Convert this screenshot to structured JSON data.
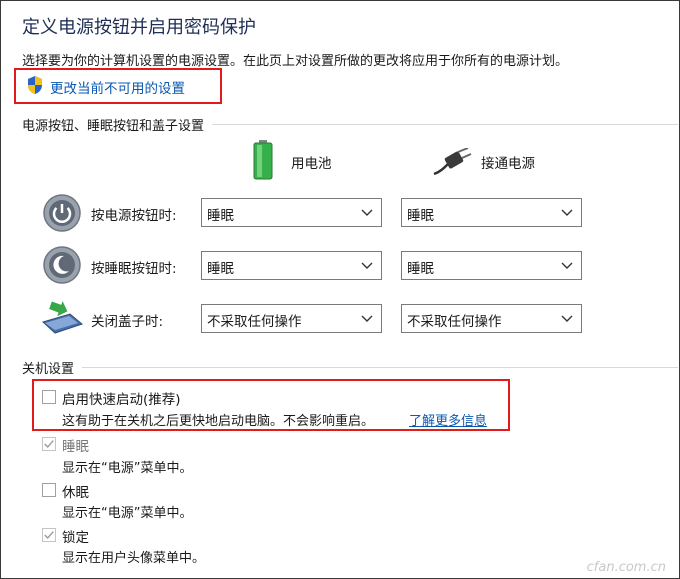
{
  "page": {
    "title": "定义电源按钮并启用密码保护",
    "description": "选择要为你的计算机设置的电源设置。在此页上对设置所做的更改将应用于你所有的电源计划。",
    "change_link": "更改当前不可用的设置"
  },
  "power_section": {
    "label": "电源按钮、睡眠按钮和盖子设置",
    "columns": {
      "battery": "用电池",
      "plugged": "接通电源"
    },
    "rows": [
      {
        "label": "按电源按钮时:",
        "battery": "睡眠",
        "plugged": "睡眠"
      },
      {
        "label": "按睡眠按钮时:",
        "battery": "睡眠",
        "plugged": "睡眠"
      },
      {
        "label": "关闭盖子时:",
        "battery": "不采取任何操作",
        "plugged": "不采取任何操作"
      }
    ]
  },
  "shutdown_section": {
    "label": "关机设置",
    "options": [
      {
        "label": "启用快速启动(推荐)",
        "checked": false,
        "desc": "这有助于在关机之后更快地启动电脑。不会影响重启。",
        "link": "了解更多信息"
      },
      {
        "label": "睡眠",
        "checked": true,
        "desc": "显示在“电源”菜单中。"
      },
      {
        "label": "休眠",
        "checked": false,
        "desc": "显示在“电源”菜单中。"
      },
      {
        "label": "锁定",
        "checked": true,
        "desc": "显示在用户头像菜单中。"
      }
    ]
  },
  "watermark": "cfan.com.cn",
  "colors": {
    "highlight": "#e11b1b",
    "link": "#0a58b0",
    "title": "#1f2f55"
  }
}
